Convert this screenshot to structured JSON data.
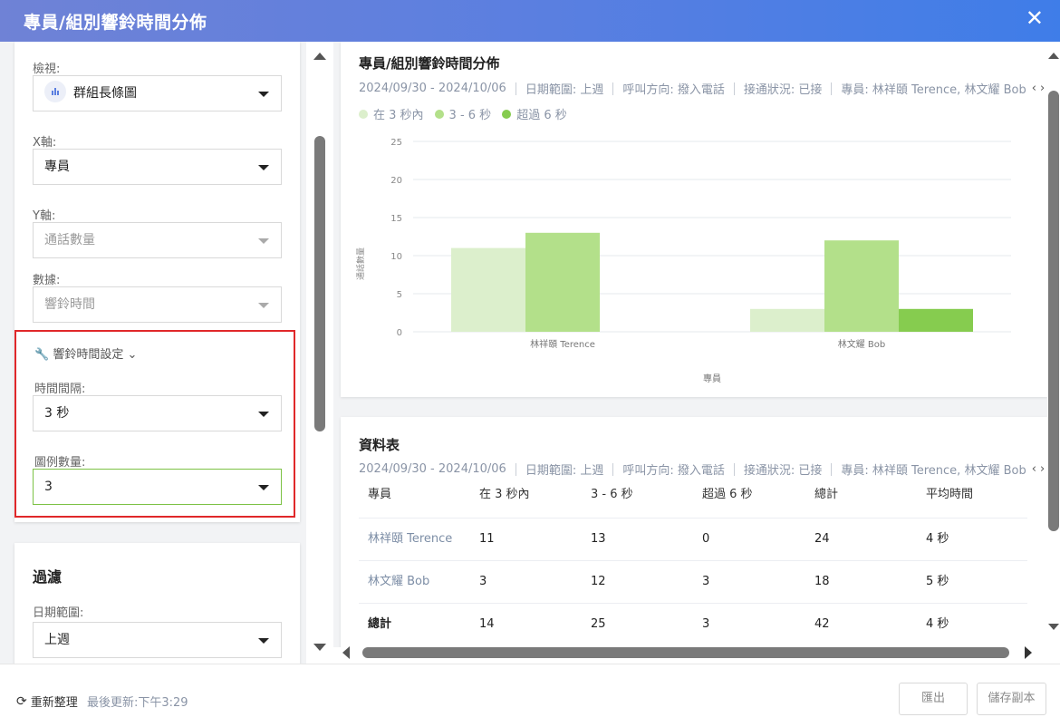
{
  "header": {
    "title": "專員/組別響鈴時間分佈",
    "close": "✕"
  },
  "settings": {
    "view_label": "檢視:",
    "view_value": "群組長條圖",
    "x_label": "X軸:",
    "x_value": "專員",
    "y_label": "Y軸:",
    "y_value": "通話數量",
    "data_label": "數據:",
    "data_value": "響鈴時間",
    "ring_settings_toggle": "響鈴時間設定",
    "interval_label": "時間間隔:",
    "interval_value": "3 秒",
    "legend_count_label": "圖例數量:",
    "legend_count_value": "3"
  },
  "filter": {
    "title": "過濾",
    "date_range_label": "日期範圍:",
    "date_range_value": "上週"
  },
  "chart_card": {
    "title": "專員/組別響鈴時間分佈",
    "meta": [
      "2024/09/30 - 2024/10/06",
      "日期範圍: 上週",
      "呼叫方向: 撥入電話",
      "接通狀況: 已接",
      "專員: 林祥頤 Terence, 林文耀 Bob"
    ],
    "meta_arrows": "‹  ›"
  },
  "chart_data": {
    "type": "bar",
    "categories": [
      "林祥頤 Terence",
      "林文耀 Bob"
    ],
    "series": [
      {
        "name": "在 3 秒內",
        "color": "#dcefcc",
        "values": [
          11,
          3
        ]
      },
      {
        "name": "3 - 6 秒",
        "color": "#b3e08a",
        "values": [
          13,
          12
        ]
      },
      {
        "name": "超過 6 秒",
        "color": "#86cc4f",
        "values": [
          0,
          3
        ]
      }
    ],
    "xlabel": "專員",
    "ylabel": "通話數量",
    "ylim": [
      0,
      25
    ],
    "yticks": [
      0,
      5,
      10,
      15,
      20,
      25
    ],
    "grid": true,
    "legend": "top-left"
  },
  "table_card": {
    "title": "資料表",
    "meta": [
      "2024/09/30 - 2024/10/06",
      "日期範圍: 上週",
      "呼叫方向: 撥入電話",
      "接通狀況: 已接",
      "專員: 林祥頤 Terence, 林文耀 Bob"
    ],
    "meta_arrows": "‹  ›",
    "columns": [
      "專員",
      "在 3 秒內",
      "3 - 6 秒",
      "超過 6 秒",
      "總計",
      "平均時間"
    ],
    "rows": [
      [
        "林祥頤 Terence",
        "11",
        "13",
        "0",
        "24",
        "4 秒"
      ],
      [
        "林文耀 Bob",
        "3",
        "12",
        "3",
        "18",
        "5 秒"
      ],
      [
        "總計",
        "14",
        "25",
        "3",
        "42",
        "4 秒"
      ]
    ]
  },
  "footer": {
    "refresh_label": "重新整理",
    "last_update": "最後更新:下午3:29",
    "export_label": "匯出",
    "save_copy_label": "儲存副本"
  }
}
